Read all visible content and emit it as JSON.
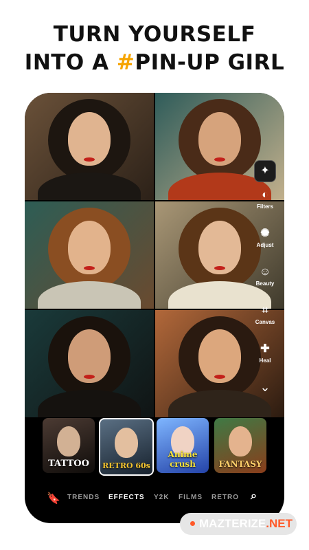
{
  "headline": {
    "line1": "TURN YOURSELF",
    "line2_pre": "INTO A ",
    "hash": "#",
    "line2_post": "PIN-UP GIRL"
  },
  "tools": [
    {
      "label": "",
      "icon": "sparkles-icon"
    },
    {
      "label": "Filters",
      "icon": "filters-icon"
    },
    {
      "label": "Adjust",
      "icon": "adjust-icon"
    },
    {
      "label": "Beauty",
      "icon": "beauty-icon"
    },
    {
      "label": "Canvas",
      "icon": "canvas-icon"
    },
    {
      "label": "Heal",
      "icon": "heal-icon"
    }
  ],
  "effects": [
    {
      "label": "TATTOO",
      "accent": "#3a2f2a"
    },
    {
      "label": "RETRO 60s",
      "accent": "#273e57"
    },
    {
      "label": "Anime crush",
      "accent": "#3b6fd6"
    },
    {
      "label": "FANTASY",
      "accent": "#7a3a18"
    }
  ],
  "tabs": [
    "TRENDS",
    "EFFECTS",
    "Y2K",
    "FILMS",
    "RETRO"
  ],
  "active_tab": "EFFECTS",
  "watermark": {
    "main": "MAZTERIZE",
    "suffix": ".NET"
  },
  "colors": {
    "accent": "#f6a400",
    "watermark_dot": "#ff5a2a"
  }
}
